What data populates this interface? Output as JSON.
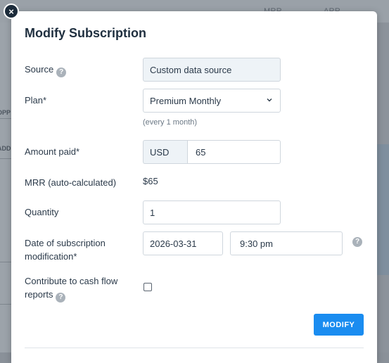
{
  "background": {
    "columns": [
      "MRR",
      "ARR"
    ],
    "tags": [
      "OPP",
      "ADD"
    ]
  },
  "modal": {
    "title": "Modify Subscription",
    "source": {
      "label": "Source",
      "value": "Custom data source"
    },
    "plan": {
      "label": "Plan*",
      "value": "Premium Monthly",
      "hint": "(every 1 month)"
    },
    "amount": {
      "label": "Amount paid*",
      "currency": "USD",
      "value": "65"
    },
    "mrr": {
      "label": "MRR (auto-calculated)",
      "value": "$65"
    },
    "quantity": {
      "label": "Quantity",
      "value": "1"
    },
    "date": {
      "label_line1": "Date of subscription",
      "label_line2": "modification*",
      "date_value": "2026-03-31",
      "time_value": "9:30 pm"
    },
    "cash_flow": {
      "label_line1": "Contribute to cash flow",
      "label_line2": "reports",
      "checked": false
    },
    "submit_label": "MODIFY",
    "close_glyph": "×",
    "help_glyph": "?"
  },
  "colors": {
    "accent": "#1a8cf0",
    "close_bg": "#1c2b3a",
    "help_icon": "#aab2ba"
  },
  "icons": [
    "close-icon",
    "help-icon",
    "chevron-down-icon",
    "checkbox"
  ]
}
